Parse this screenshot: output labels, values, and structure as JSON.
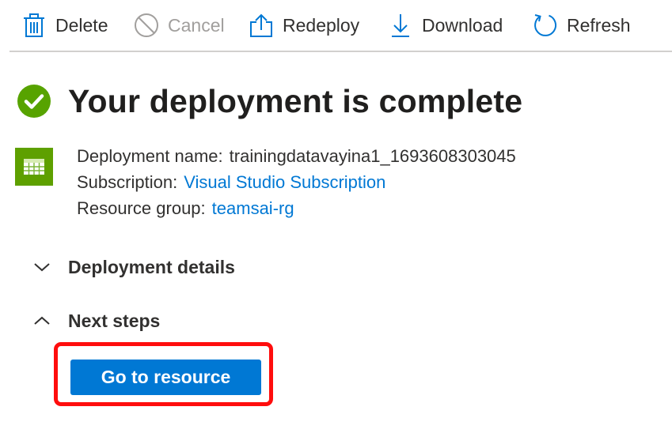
{
  "toolbar": {
    "delete": {
      "label": "Delete",
      "icon": "trash-icon"
    },
    "cancel": {
      "label": "Cancel",
      "icon": "cancel-icon",
      "disabled": true
    },
    "redeploy": {
      "label": "Redeploy",
      "icon": "upload-icon"
    },
    "download": {
      "label": "Download",
      "icon": "download-icon"
    },
    "refresh": {
      "label": "Refresh",
      "icon": "refresh-icon"
    }
  },
  "status": {
    "title": "Your deployment is complete",
    "icon": "success-check-icon",
    "color": "#57a300"
  },
  "deployment": {
    "icon": "resource-group-icon",
    "name_label": "Deployment name:",
    "name_value": "trainingdatavayina1_1693608303045",
    "subscription_label": "Subscription:",
    "subscription_value": "Visual Studio Subscription",
    "resource_group_label": "Resource group:",
    "resource_group_value": "teamsai-rg"
  },
  "sections": {
    "details": {
      "title": "Deployment details",
      "expanded": false
    },
    "next_steps": {
      "title": "Next steps",
      "expanded": true
    }
  },
  "primary_button": {
    "label": "Go to resource"
  },
  "colors": {
    "accent": "#0078d4",
    "success": "#57a300",
    "highlight": "#ff0d0d",
    "resource_green": "#5ea000"
  }
}
